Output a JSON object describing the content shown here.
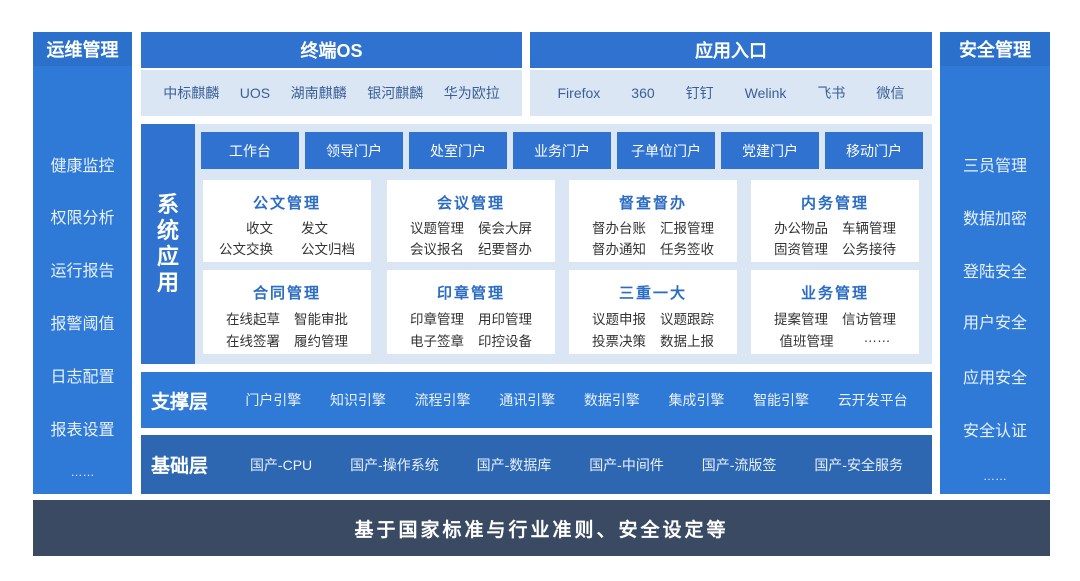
{
  "left_panel": {
    "title": "运维管理",
    "items": [
      "健康监控",
      "权限分析",
      "运行报告",
      "报警阈值",
      "日志配置",
      "报表设置",
      "……"
    ]
  },
  "right_panel": {
    "title": "安全管理",
    "items": [
      "三员管理",
      "数据加密",
      "登陆安全",
      "用户安全",
      "应用安全",
      "安全认证",
      "……"
    ]
  },
  "terminal_os": {
    "title": "终端OS",
    "items": [
      "中标麒麟",
      "UOS",
      "湖南麒麟",
      "银河麒麟",
      "华为欧拉"
    ]
  },
  "app_entry": {
    "title": "应用入口",
    "items": [
      "Firefox",
      "360",
      "钉钉",
      "Welink",
      "飞书",
      "微信"
    ]
  },
  "system_apps": {
    "label": [
      "系",
      "统",
      "应",
      "用"
    ],
    "portals": [
      "工作台",
      "领导门户",
      "处室门户",
      "业务门户",
      "子单位门户",
      "党建门户",
      "移动门户"
    ],
    "modules": [
      {
        "title": "公文管理",
        "rows": [
          [
            "收文",
            "发文"
          ],
          [
            "公文交换",
            "公文归档"
          ]
        ]
      },
      {
        "title": "会议管理",
        "rows": [
          [
            "议题管理",
            "侯会大屏"
          ],
          [
            "会议报名",
            "纪要督办"
          ]
        ]
      },
      {
        "title": "督查督办",
        "rows": [
          [
            "督办台账",
            "汇报管理"
          ],
          [
            "督办通知",
            "任务签收"
          ]
        ]
      },
      {
        "title": "内务管理",
        "rows": [
          [
            "办公物品",
            "车辆管理"
          ],
          [
            "固资管理",
            "公务接待"
          ]
        ]
      },
      {
        "title": "合同管理",
        "rows": [
          [
            "在线起草",
            "智能审批"
          ],
          [
            "在线签署",
            "履约管理"
          ]
        ]
      },
      {
        "title": "印章管理",
        "rows": [
          [
            "印章管理",
            "用印管理"
          ],
          [
            "电子签章",
            "印控设备"
          ]
        ]
      },
      {
        "title": "三重一大",
        "rows": [
          [
            "议题申报",
            "议题跟踪"
          ],
          [
            "投票决策",
            "数据上报"
          ]
        ]
      },
      {
        "title": "业务管理",
        "rows": [
          [
            "提案管理",
            "信访管理"
          ],
          [
            "值班管理",
            "……"
          ]
        ]
      }
    ]
  },
  "support_layer": {
    "title": "支撑层",
    "items": [
      "门户引擎",
      "知识引擎",
      "流程引擎",
      "通讯引擎",
      "数据引擎",
      "集成引擎",
      "智能引擎",
      "云开发平台"
    ]
  },
  "base_layer": {
    "title": "基础层",
    "items": [
      "国产-CPU",
      "国产-操作系统",
      "国产-数据库",
      "国产-中间件",
      "国产-流版签",
      "国产-安全服务"
    ]
  },
  "footer": "基于国家标准与行业准则、安全设定等",
  "colors": {
    "primary": "#2f72cf",
    "light_panel": "#dbe6f4",
    "footer": "#3a4a62",
    "base": "#2e67b1"
  }
}
